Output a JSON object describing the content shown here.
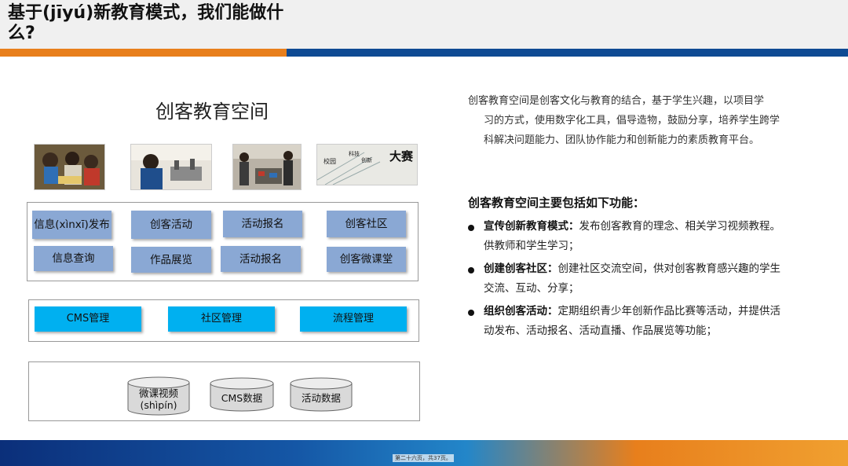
{
  "title": "基于(jīyú)新教育模式，我们能做什么?",
  "diagram": {
    "title": "创客教育空间",
    "photo4_text": [
      "校园",
      "科技",
      "创新",
      "大赛"
    ],
    "row1": [
      "信息(xìnxī)发布",
      "创客活动",
      "活动报名",
      "创客社区"
    ],
    "row2": [
      "信息查询",
      "作品展览",
      "活动报名",
      "创客微课堂"
    ],
    "row3": [
      "CMS管理",
      "社区管理",
      "流程管理"
    ],
    "data": [
      "微课视频(shìpín)",
      "CMS数据",
      "活动数据"
    ]
  },
  "right": {
    "intro_first": "创客教育空间是创客文化与教育的结合，基于学生兴趣，以项目学",
    "intro_rest": "习的方式，使用数字化工具，倡导造物，鼓励分享，培养学生跨学科解决问题能力、团队协作能力和创新能力的素质教育平台。",
    "func_title": "创客教育空间主要包括如下功能：",
    "features": [
      {
        "head": "宣传创新教育模式：",
        "text": "发布创客教育的理念、相关学习视频教程。供教师和学生学习；"
      },
      {
        "head": "创建创客社区：",
        "text": "创建社区交流空间，供对创客教育感兴趣的学生交流、互动、分享；"
      },
      {
        "head": "组织创客活动：",
        "text": "定期组织青少年创新作品比赛等活动，并提供活动发布、活动报名、活动直播、作品展览等功能；"
      }
    ]
  },
  "footer": {
    "page": "第二十六页，共37页。"
  },
  "colors": {
    "orange": "#e87f1c",
    "navy": "#0e4a93",
    "module_blue": "#8aa8d4",
    "module_cyan": "#00b0f0"
  }
}
